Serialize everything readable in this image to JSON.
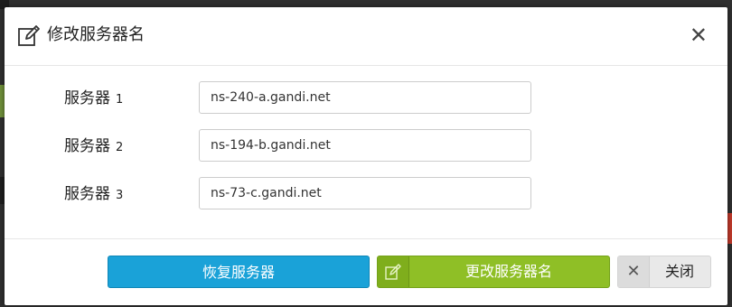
{
  "dialog": {
    "title": "修改服务器名",
    "close_glyph": "✕"
  },
  "servers": [
    {
      "label": "服务器",
      "index": "1",
      "value": "ns-240-a.gandi.net"
    },
    {
      "label": "服务器",
      "index": "2",
      "value": "ns-194-b.gandi.net"
    },
    {
      "label": "服务器",
      "index": "3",
      "value": "ns-73-c.gandi.net"
    }
  ],
  "footer": {
    "restore_label": "恢复服务器",
    "change_label": "更改服务器名",
    "close_label": "关闭",
    "close_icon_glyph": "✕"
  },
  "colors": {
    "restore_button": "#1aa2d8",
    "change_button": "#8fbf26",
    "close_button": "#e9e9e9"
  },
  "icons": {
    "header": "edit-icon",
    "change": "edit-icon",
    "close": "close-icon"
  }
}
